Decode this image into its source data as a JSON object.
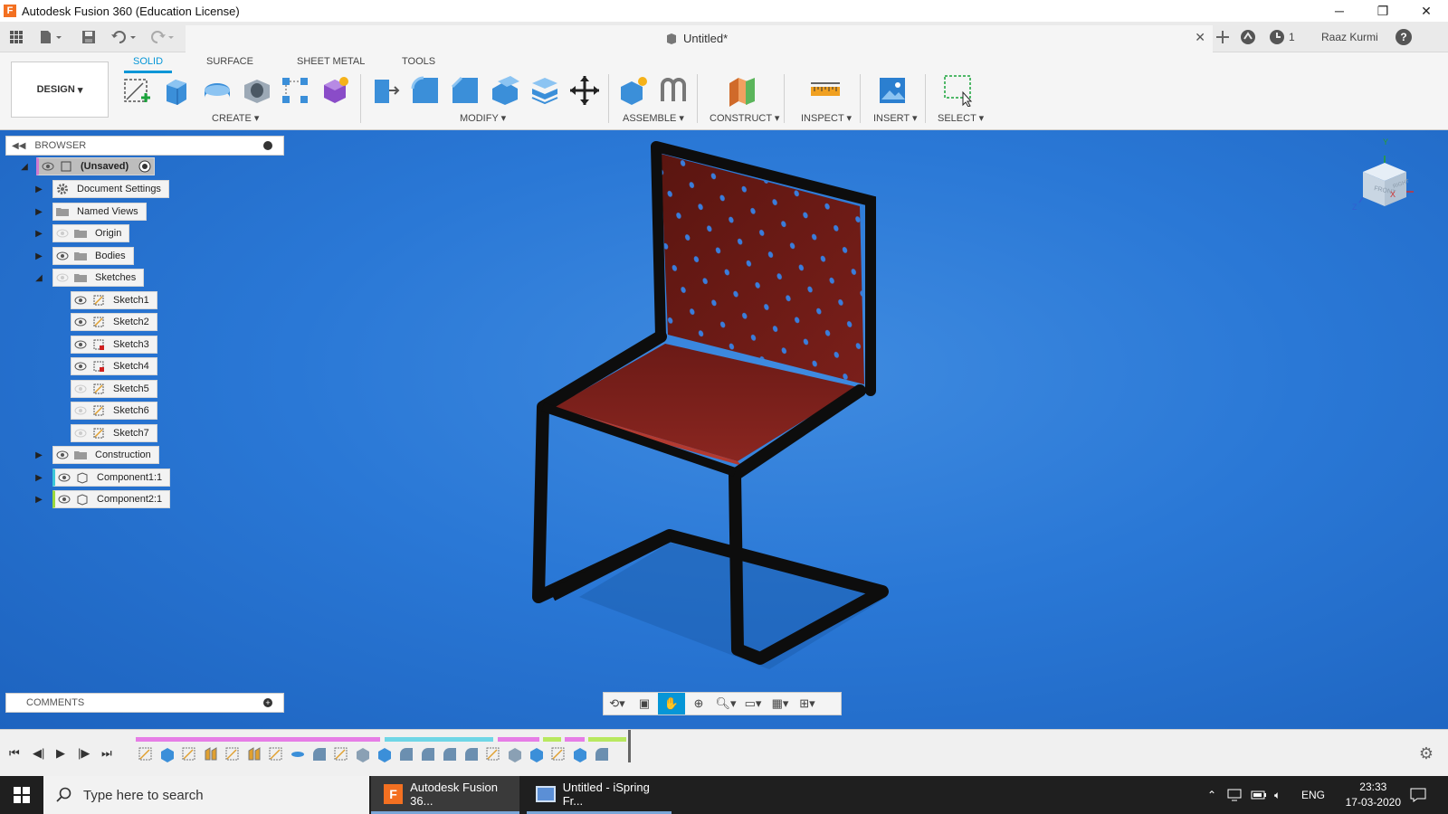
{
  "window": {
    "title": "Autodesk Fusion 360 (Education License)",
    "logo_letter": "F",
    "minimize": "─",
    "restore": "❐",
    "close": "✕"
  },
  "quickbar": {
    "doc_title": "Untitled*",
    "user": "Raaz Kurmi",
    "job_count": "1",
    "help": "?"
  },
  "ribbon": {
    "workspace": "DESIGN",
    "tabs": [
      "SOLID",
      "SURFACE",
      "SHEET METAL",
      "TOOLS"
    ],
    "active_tab": "SOLID",
    "groups": [
      "CREATE",
      "MODIFY",
      "ASSEMBLE",
      "CONSTRUCT",
      "INSPECT",
      "INSERT",
      "SELECT"
    ]
  },
  "browser": {
    "title": "BROWSER",
    "root": "(Unsaved)",
    "items": [
      {
        "label": "Document Settings",
        "icon": "gear-icon"
      },
      {
        "label": "Named Views",
        "icon": "folder-icon"
      },
      {
        "label": "Origin",
        "icon": "folder-icon"
      },
      {
        "label": "Bodies",
        "icon": "folder-icon"
      },
      {
        "label": "Sketches",
        "icon": "folder-icon"
      }
    ],
    "sketches": [
      "Sketch1",
      "Sketch2",
      "Sketch3",
      "Sketch4",
      "Sketch5",
      "Sketch6",
      "Sketch7"
    ],
    "after": [
      {
        "label": "Construction",
        "icon": "folder-icon"
      },
      {
        "label": "Component1:1",
        "icon": "component-icon"
      },
      {
        "label": "Component2:1",
        "icon": "component-icon"
      }
    ]
  },
  "comments": {
    "title": "COMMENTS"
  },
  "viewcube": {
    "front": "FRONT",
    "right": "RIGHT",
    "axis_x": "X",
    "axis_y": "Y",
    "axis_z": "Z"
  },
  "taskbar": {
    "search_placeholder": "Type here to search",
    "apps": [
      {
        "label": "Autodesk Fusion 36...",
        "active": true
      },
      {
        "label": "Untitled - iSpring Fr...",
        "active": false
      }
    ],
    "language": "ENG",
    "time": "23:33",
    "date": "17-03-2020"
  },
  "colors": {
    "accent": "#0696d7",
    "viewport": "#2a78d6",
    "chair_frame": "#111111",
    "chair_seat": "#7a1f1a"
  }
}
